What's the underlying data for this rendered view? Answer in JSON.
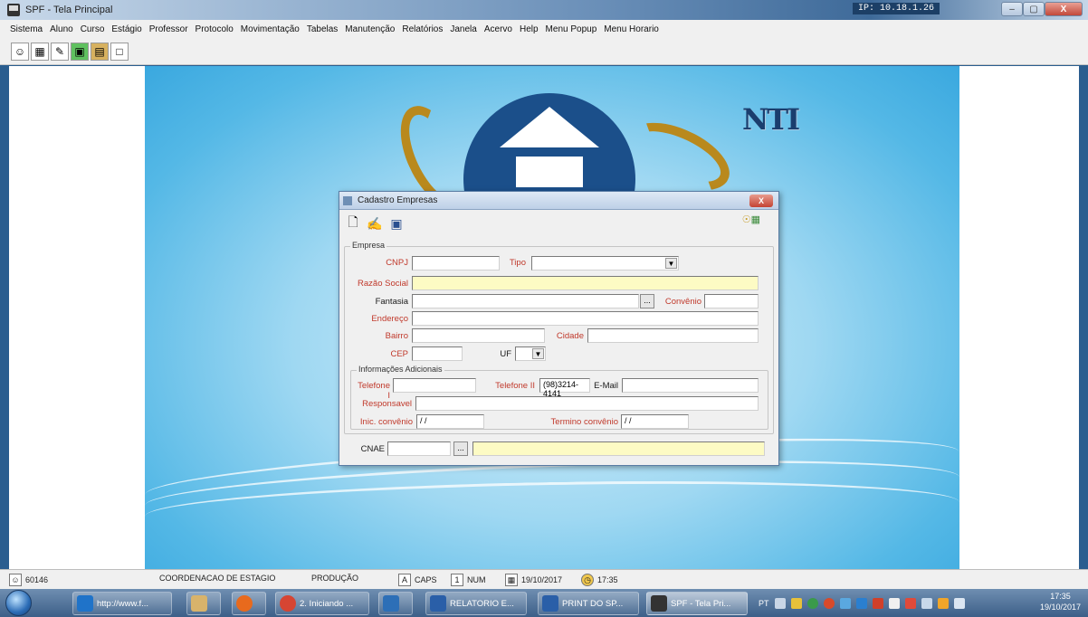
{
  "window": {
    "title": "SPF - Tela Principal",
    "ip": "IP: 10.18.1.26",
    "minimize": "–",
    "restore": "▢",
    "close": "X"
  },
  "menu": [
    "Sistema",
    "Aluno",
    "Curso",
    "Estágio",
    "Professor",
    "Protocolo",
    "Movimentação",
    "Tabelas",
    "Manutenção",
    "Relatórios",
    "Janela",
    "Acervo",
    "Help",
    "Menu Popup",
    "Menu Horario"
  ],
  "toolbar_icons": [
    "user-icon",
    "grid-icon",
    "search-icon",
    "chart-icon",
    "image-icon",
    "window-icon"
  ],
  "logo": {
    "text": "NTI"
  },
  "dialog": {
    "title": "Cadastro Empresas",
    "close": "X",
    "empresa_group": "Empresa",
    "cnpj_label": "CNPJ",
    "cnpj_value": "",
    "tipo_label": "Tipo",
    "tipo_value": "",
    "razao_label": "Razão Social",
    "razao_value": "",
    "fantasia_label": "Fantasia",
    "fantasia_value": "",
    "convenio_label": "Convênio",
    "convenio_value": "",
    "endereco_label": "Endereço",
    "endereco_value": "",
    "bairro_label": "Bairro",
    "bairro_value": "",
    "cidade_label": "Cidade",
    "cidade_value": "",
    "cep_label": "CEP",
    "cep_value": "",
    "uf_label": "UF",
    "uf_value": "",
    "info_group": "Informações Adicionais",
    "telefone1_label": "Telefone I",
    "telefone1_value": "",
    "telefone2_label": "Telefone II",
    "telefone2_value": "(98)3214-4141",
    "email_label": "E-Mail",
    "email_value": "",
    "responsavel_label": "Responsavel",
    "responsavel_value": "",
    "inicio_label": "Inic. convênio",
    "inicio_value": "/ /",
    "termino_label": "Termino convênio",
    "termino_value": "/ /",
    "cnae_label": "CNAE",
    "cnae_value": "",
    "cnae_desc": "",
    "ellipsis": "..."
  },
  "status": {
    "user_id": "60146",
    "department": "COORDENACAO DE ESTAGIO",
    "environment": "PRODUÇÃO",
    "caps": "CAPS",
    "num": "NUM",
    "date": "19/10/2017",
    "time": "17:35"
  },
  "taskbar": {
    "tasks": [
      {
        "label": "http://www.f...",
        "color": "#1f73c9"
      },
      {
        "label": "",
        "color": "#d8b36b"
      },
      {
        "label": "",
        "color": "#e86a1d"
      },
      {
        "label": "2. Iniciando ...",
        "color": "#d64533"
      },
      {
        "label": "",
        "color": "#2d6fb7"
      },
      {
        "label": "RELATORIO E...",
        "color": "#2a5fa8"
      },
      {
        "label": "PRINT DO SP...",
        "color": "#2a5fa8"
      },
      {
        "label": "SPF - Tela Pri...",
        "color": "#333333"
      }
    ],
    "lang": "PT",
    "clock_time": "17:35",
    "clock_date": "19/10/2017"
  }
}
